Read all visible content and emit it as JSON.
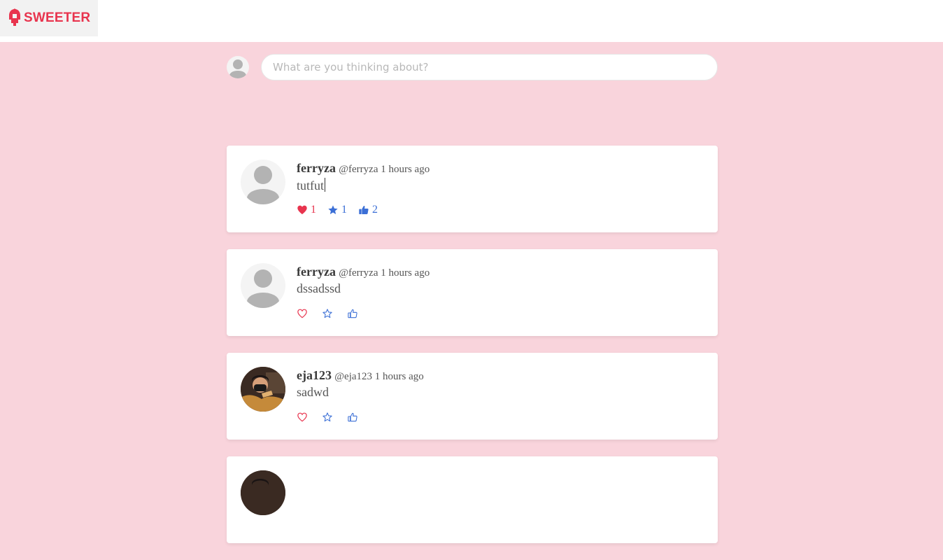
{
  "app": {
    "name": "SWEETER",
    "brand_color": "#e8344e"
  },
  "composer": {
    "placeholder": "What are you thinking about?",
    "avatar_icon": "default-user-avatar"
  },
  "colors": {
    "background": "#f9d4dc",
    "like": "#e8344e",
    "star": "#3b6fd6",
    "thumb": "#3b6fd6"
  },
  "posts": [
    {
      "name": "ferryza",
      "meta": "@ferryza 1 hours ago",
      "text": "tutfut",
      "avatar": "default-user-avatar",
      "likes": "1",
      "stars": "1",
      "thumbs": "2",
      "liked": true
    },
    {
      "name": "ferryza",
      "meta": "@ferryza 1 hours ago",
      "text": "dssadssd",
      "avatar": "default-user-avatar",
      "likes": "",
      "stars": "",
      "thumbs": "",
      "liked": false
    },
    {
      "name": "eja123",
      "meta": "@eja123 1 hours ago",
      "text": "sadwd",
      "avatar": "user-photo",
      "likes": "",
      "stars": "",
      "thumbs": "",
      "liked": false
    }
  ]
}
